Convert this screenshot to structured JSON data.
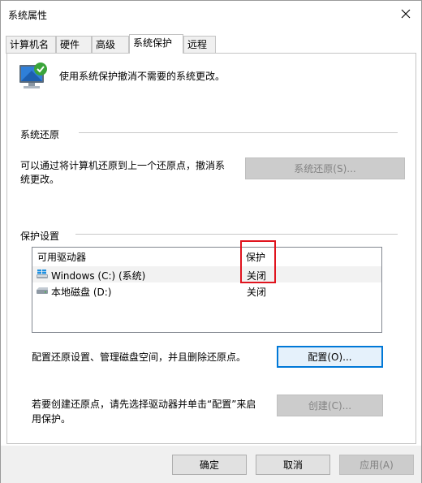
{
  "window": {
    "title": "系统属性"
  },
  "tabs": [
    {
      "label": "计算机名"
    },
    {
      "label": "硬件"
    },
    {
      "label": "高级"
    },
    {
      "label": "系统保护",
      "active": true
    },
    {
      "label": "远程"
    }
  ],
  "header": {
    "description": "使用系统保护撤消不需要的系统更改。",
    "icon": "computer-protection-icon"
  },
  "restore": {
    "title": "系统还原",
    "description_line1": "可以通过将计算机还原到上一个还原点，撤消系",
    "description_line2": "统更改。",
    "button": "系统还原(S)..."
  },
  "protection": {
    "title": "保护设置",
    "columns": [
      "可用驱动器",
      "保护"
    ],
    "drives": [
      {
        "name": "Windows  (C:) (系统)",
        "status": "关闭",
        "icon": "windows-drive-icon"
      },
      {
        "name": "本地磁盘 (D:)",
        "status": "关闭",
        "icon": "hard-drive-icon"
      }
    ]
  },
  "configure": {
    "description": "配置还原设置、管理磁盘空间，并且删除还原点。",
    "button": "配置(O)..."
  },
  "create": {
    "description_line1": "若要创建还原点，请先选择驱动器并单击“配置”来启",
    "description_line2": "用保护。",
    "button": "创建(C)..."
  },
  "footer": {
    "ok": "确定",
    "cancel": "取消",
    "apply": "应用(A)",
    "leftover_left": "…",
    "leftover_right": "…"
  },
  "colors": {
    "highlight_box": "#e0141e",
    "focus": "#0078d7"
  }
}
